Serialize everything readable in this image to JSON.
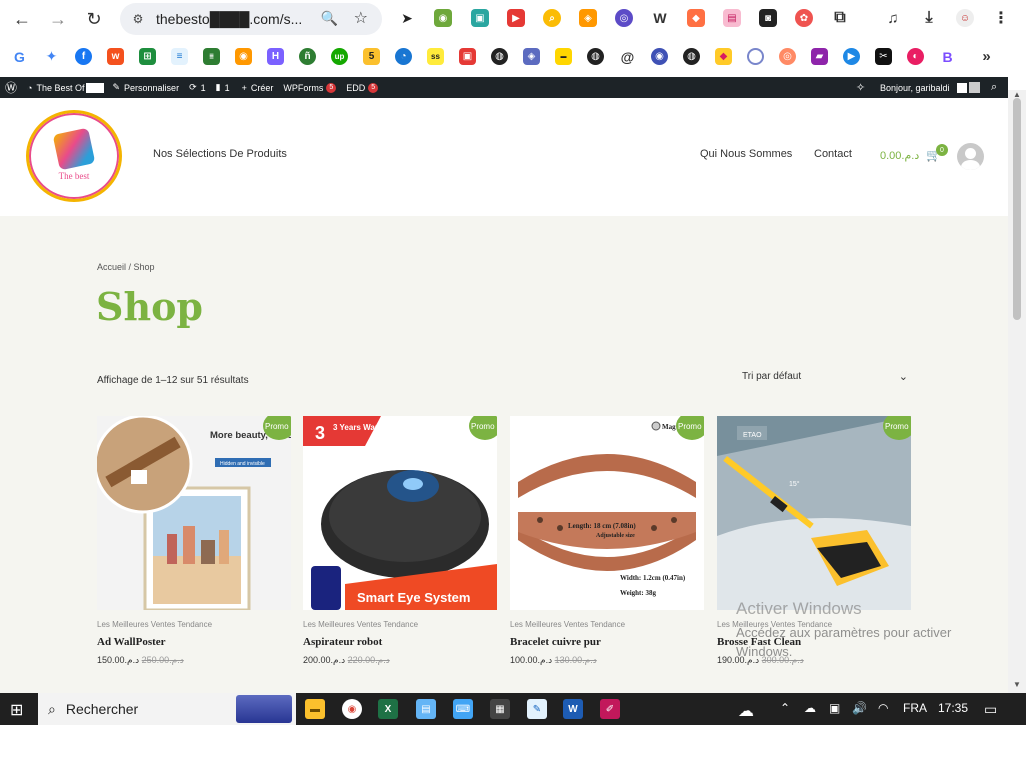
{
  "browser": {
    "url": "thebesto████.com/s...",
    "back_icon": "←",
    "forward_icon": "→",
    "reload_icon": "↻",
    "zoom_icon": "🔍",
    "star_icon": "☆",
    "menu_icon": "⋮"
  },
  "bookmarks_more": "»",
  "wp_admin": {
    "site_name": "The Best Of",
    "customize": "Personnaliser",
    "updates_count": "1",
    "comments_count": "1",
    "create": "Créer",
    "wpforms": "WPForms",
    "wpforms_badge": "5",
    "edd": "EDD",
    "edd_badge": "5",
    "greeting": "Bonjour, garibaldi"
  },
  "header": {
    "logo_text": "The best",
    "nav_left": "Nos Sélections De Produits",
    "nav_right": [
      "Qui Nous Sommes",
      "Contact"
    ],
    "cart_total": "د.م.0.00",
    "cart_count": "0"
  },
  "page": {
    "breadcrumb": "Accueil / Shop",
    "title": "Shop",
    "result_count": "Affichage de 1–12 sur 51 résultats",
    "sort_label": "Tri par défaut"
  },
  "products": [
    {
      "category": "Les Meilleures Ventes Tendance",
      "name": "Ad WallPoster",
      "old_price": "د.م.250.00",
      "price": "د.م.150.00",
      "badge": "Promo !",
      "img_text": "More beauty, concealment"
    },
    {
      "category": "Les Meilleures Ventes Tendance",
      "name": "Aspirateur robot",
      "old_price": "د.م.220.00",
      "price": "د.م.200.00",
      "badge": "Promo !",
      "img_text": "Smart Eye System",
      "img_text2": "3 Years Warranty"
    },
    {
      "category": "Les Meilleures Ventes Tendance",
      "name": "Bracelet cuivre pur",
      "old_price": "د.م.130.00",
      "price": "د.م.100.00",
      "badge": "Promo !",
      "img_text": "Length: 18 cm (7.08in)",
      "img_text2": "Adjustable size",
      "img_text3": "Width: 1.2cm (0.47in)",
      "img_text4": "Weight: 38g"
    },
    {
      "category": "Les Meilleures Ventes Tendance",
      "name": "Brosse Fast Clean",
      "old_price": "د.م.300.00",
      "price": "د.م.190.00",
      "badge": "Promo !",
      "img_text": "15°"
    }
  ],
  "windows_watermark": {
    "title": "Activer Windows",
    "subtitle": "Accédez aux paramètres pour activer Windows."
  },
  "taskbar": {
    "search_label": "Rechercher",
    "lang": "FRA",
    "time": "17:35"
  }
}
